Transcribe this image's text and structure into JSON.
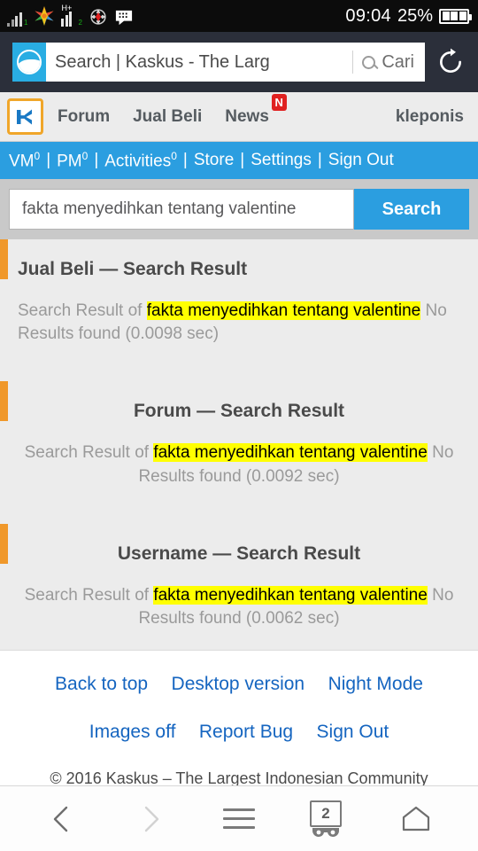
{
  "status_bar": {
    "time": "09:04",
    "battery_percent": "25%",
    "signal_label_1": "1",
    "signal_label_2": "2",
    "network_type": "H+",
    "icons": [
      "signal-bars-icon",
      "app-star-icon",
      "hsdpa-signal-icon",
      "navigation-compass-icon",
      "bbm-chat-icon",
      "battery-icon"
    ]
  },
  "browser": {
    "favicon_name": "uc-browser-icon",
    "page_title": "Search | Kaskus - The Larg",
    "search_placeholder": "Cari",
    "reload_label": "reload-icon"
  },
  "site_header": {
    "logo_name": "kaskus-logo",
    "nav": [
      {
        "label": "Forum",
        "badge": null
      },
      {
        "label": "Jual Beli",
        "badge": null
      },
      {
        "label": "News",
        "badge": "N"
      }
    ],
    "username": "kleponis"
  },
  "blue_nav": {
    "items": [
      {
        "label": "VM",
        "count": "0"
      },
      {
        "label": "PM",
        "count": "0"
      },
      {
        "label": "Activities",
        "count": "0"
      },
      {
        "label": "Store",
        "count": ""
      },
      {
        "label": "Settings",
        "count": ""
      },
      {
        "label": "Sign Out",
        "count": ""
      }
    ],
    "separator": "|"
  },
  "search": {
    "query": "fakta menyedihkan tentang valentine",
    "placeholder": "",
    "button_label": "Search"
  },
  "results": [
    {
      "title": "Jual Beli — Search Result",
      "align": "left",
      "prefix": "Search Result of ",
      "highlight": "fakta menyedihkan tentang valentine",
      "suffix": " No Results found (0.0098 sec)",
      "time": "0.0098 sec"
    },
    {
      "title": "Forum — Search Result",
      "align": "center",
      "prefix": "Search Result of ",
      "highlight": "fakta menyedihkan tentang valentine",
      "suffix": " No Results found (0.0092 sec)",
      "time": "0.0092 sec"
    },
    {
      "title": "Username — Search Result",
      "align": "center",
      "prefix": "Search Result of ",
      "highlight": "fakta menyedihkan tentang valentine",
      "suffix": "  No Results found (0.0062 sec)",
      "time": "0.0062 sec"
    }
  ],
  "footer": {
    "row1": [
      "Back to top",
      "Desktop version",
      "Night Mode"
    ],
    "row2": [
      "Images off",
      "Report Bug",
      "Sign Out"
    ],
    "copyright": "© 2016 Kaskus – The Largest Indonesian Community"
  },
  "bottom_nav": {
    "back": "back-icon",
    "forward": "forward-icon",
    "menu": "menu-icon",
    "tabs_count": "2",
    "home": "home-icon"
  },
  "colors": {
    "accent_blue": "#2b9ee0",
    "accent_orange": "#f0982a",
    "link_blue": "#1565c0",
    "highlight_yellow": "#ffff00",
    "page_bg": "#ececec"
  }
}
